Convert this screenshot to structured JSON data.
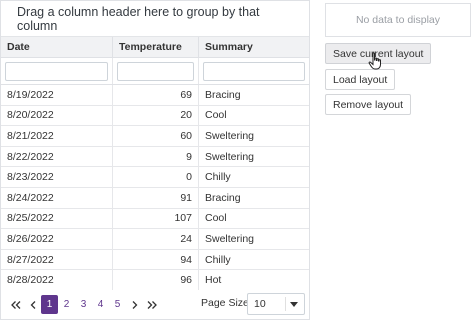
{
  "grid": {
    "group_panel_text": "Drag a column header here to group by that column",
    "columns": [
      "Date",
      "Temperature",
      "Summary"
    ],
    "rows": [
      [
        "8/19/2022",
        "69",
        "Bracing"
      ],
      [
        "8/20/2022",
        "20",
        "Cool"
      ],
      [
        "8/21/2022",
        "60",
        "Sweltering"
      ],
      [
        "8/22/2022",
        "9",
        "Sweltering"
      ],
      [
        "8/23/2022",
        "0",
        "Chilly"
      ],
      [
        "8/24/2022",
        "91",
        "Bracing"
      ],
      [
        "8/25/2022",
        "107",
        "Cool"
      ],
      [
        "8/26/2022",
        "24",
        "Sweltering"
      ],
      [
        "8/27/2022",
        "94",
        "Chilly"
      ],
      [
        "8/28/2022",
        "96",
        "Hot"
      ]
    ]
  },
  "pager": {
    "first_icon": "double-chevron-left-icon",
    "prev_icon": "chevron-left-icon",
    "next_icon": "chevron-right-icon",
    "last_icon": "double-chevron-right-icon",
    "pages": [
      "1",
      "2",
      "3",
      "4",
      "5"
    ],
    "active_page": "1",
    "page_size_label": "Page Size:",
    "page_size_value": "10",
    "accent_color": "#5f368d"
  },
  "side_panel": {
    "no_data_text": "No data to display",
    "save_label": "Save current layout",
    "load_label": "Load layout",
    "remove_label": "Remove layout"
  }
}
